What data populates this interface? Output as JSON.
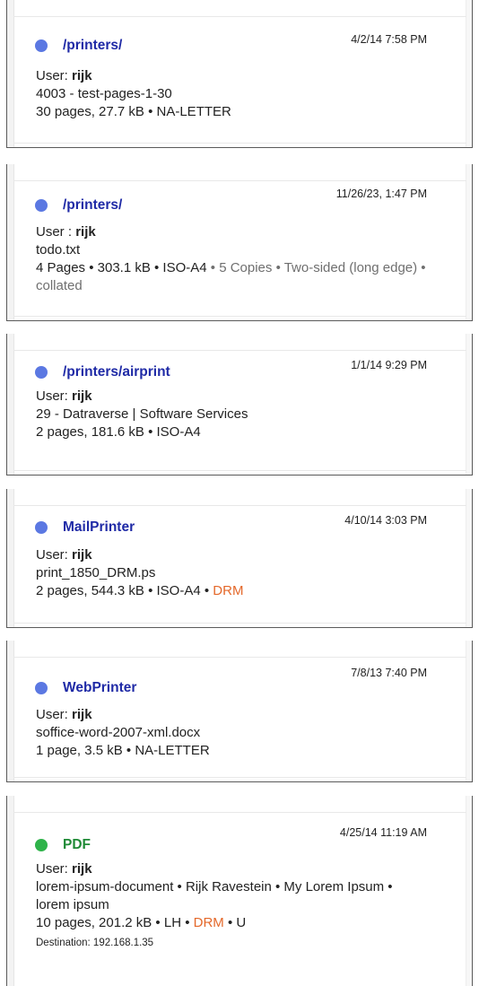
{
  "jobs": [
    {
      "timestamp": "4/2/14 7:58 PM",
      "printer": "/printers/",
      "user_label": "User:",
      "user": "rijk",
      "line1": "4003 - test-pages-1-30",
      "line2": "30 pages, 27.7 kB • NA-LETTER"
    },
    {
      "timestamp": "11/26/23, 1:47 PM",
      "printer": "/printers/",
      "user_label": "User :",
      "user": "rijk",
      "line1": "todo.txt",
      "line2a": "4 Pages • 303.1 kB • ISO-A4",
      "line2b": " • 5 Copies • Two-sided (long edge) • collated"
    },
    {
      "timestamp": "1/1/14 9:29 PM",
      "printer": "/printers/airprint",
      "user_label": "User:",
      "user": "rijk",
      "line1": "29 - Datraverse | Software Services",
      "line2": "2 pages, 181.6 kB • ISO-A4"
    },
    {
      "timestamp": "4/10/14 3:03 PM",
      "printer": "MailPrinter",
      "user_label": "User:",
      "user": "rijk",
      "line1": "print_1850_DRM.ps",
      "line2": "2 pages, 544.3 kB • ISO-A4 • ",
      "drm": "DRM"
    },
    {
      "timestamp": "7/8/13 7:40 PM",
      "printer": "WebPrinter",
      "user_label": "User:",
      "user": "rijk",
      "line1": "soffice-word-2007-xml.docx",
      "line2": "1 page, 3.5 kB • NA-LETTER"
    },
    {
      "timestamp": "4/25/14 11:19 AM",
      "printer": "PDF",
      "user_label": "User:",
      "user": "rijk",
      "line1": "lorem-ipsum-document • Rijk Ravestein • My Lorem Ipsum • lorem ipsum",
      "line2": "10 pages, 201.2 kB • LH • ",
      "drm": "DRM",
      "line2_tail": " • U",
      "destination": "Destination: 192.168.1.35"
    }
  ],
  "colors": {
    "printer_dot": "#5b78e2",
    "pdf_dot": "#2fb34a",
    "printer_title": "#1f2aa6",
    "pdf_title": "#1f8a36",
    "drm": "#e4682a"
  }
}
